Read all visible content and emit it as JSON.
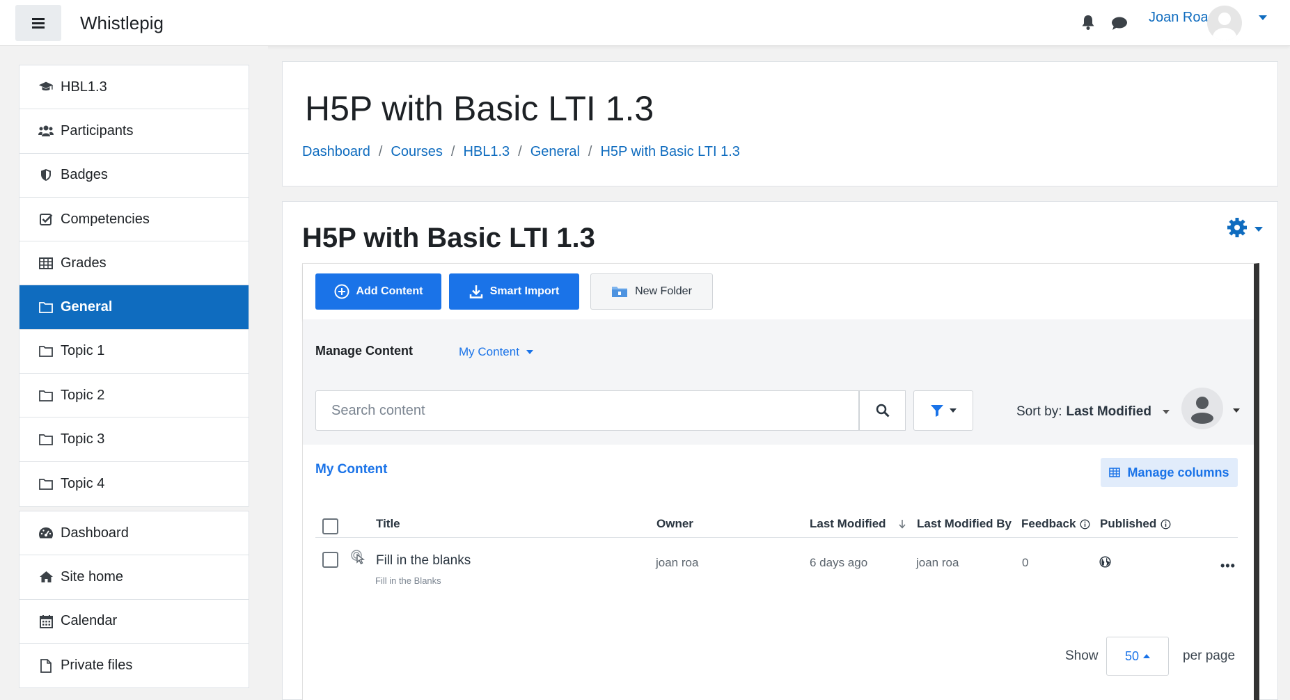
{
  "navbar": {
    "site_name": "Whistlepig",
    "user_name": "Joan Roa",
    "icons": {
      "menu": "hamburger-icon",
      "notifications": "bell-icon",
      "messages": "chat-icon"
    }
  },
  "drawer": {
    "course_items": [
      {
        "label": "HBL1.3",
        "icon": "graduation-cap-icon"
      },
      {
        "label": "Participants",
        "icon": "users-icon"
      },
      {
        "label": "Badges",
        "icon": "shield-icon"
      },
      {
        "label": "Competencies",
        "icon": "checkbox-icon"
      },
      {
        "label": "Grades",
        "icon": "table-icon"
      },
      {
        "label": "General",
        "icon": "folder-icon",
        "active": true
      },
      {
        "label": "Topic 1",
        "icon": "folder-icon"
      },
      {
        "label": "Topic 2",
        "icon": "folder-icon"
      },
      {
        "label": "Topic 3",
        "icon": "folder-icon"
      },
      {
        "label": "Topic 4",
        "icon": "folder-icon"
      }
    ],
    "site_items": [
      {
        "label": "Dashboard",
        "icon": "tachometer-icon"
      },
      {
        "label": "Site home",
        "icon": "home-icon"
      },
      {
        "label": "Calendar",
        "icon": "calendar-icon"
      },
      {
        "label": "Private files",
        "icon": "file-icon"
      }
    ]
  },
  "header": {
    "title": "H5P with Basic LTI 1.3",
    "breadcrumb": [
      "Dashboard",
      "Courses",
      "HBL1.3",
      "General",
      "H5P with Basic LTI 1.3"
    ]
  },
  "activity": {
    "title": "H5P with Basic LTI 1.3"
  },
  "h5p": {
    "toolbar": {
      "add_content": "Add Content",
      "smart_import": "Smart Import",
      "new_folder": "New Folder"
    },
    "manage": {
      "label": "Manage Content",
      "dropdown_value": "My Content",
      "search_placeholder": "Search content",
      "sort_prefix": "Sort by:",
      "sort_value": "Last Modified"
    },
    "list": {
      "heading": "My Content",
      "manage_columns": "Manage columns",
      "columns": [
        "Title",
        "Owner",
        "Last Modified",
        "Last Modified By",
        "Feedback",
        "Published"
      ],
      "rows": [
        {
          "title": "Fill in the blanks",
          "subtitle": "Fill in the Blanks",
          "owner": "joan roa",
          "last_modified": "6 days ago",
          "last_modified_by": "joan roa",
          "feedback": "0",
          "published_icon": "globe-icon"
        }
      ]
    },
    "pager": {
      "show": "Show",
      "per_page_value": "50",
      "per_page": "per page"
    }
  },
  "colors": {
    "brand": "#0f6cbf",
    "h5p_blue": "#1a73e8"
  }
}
